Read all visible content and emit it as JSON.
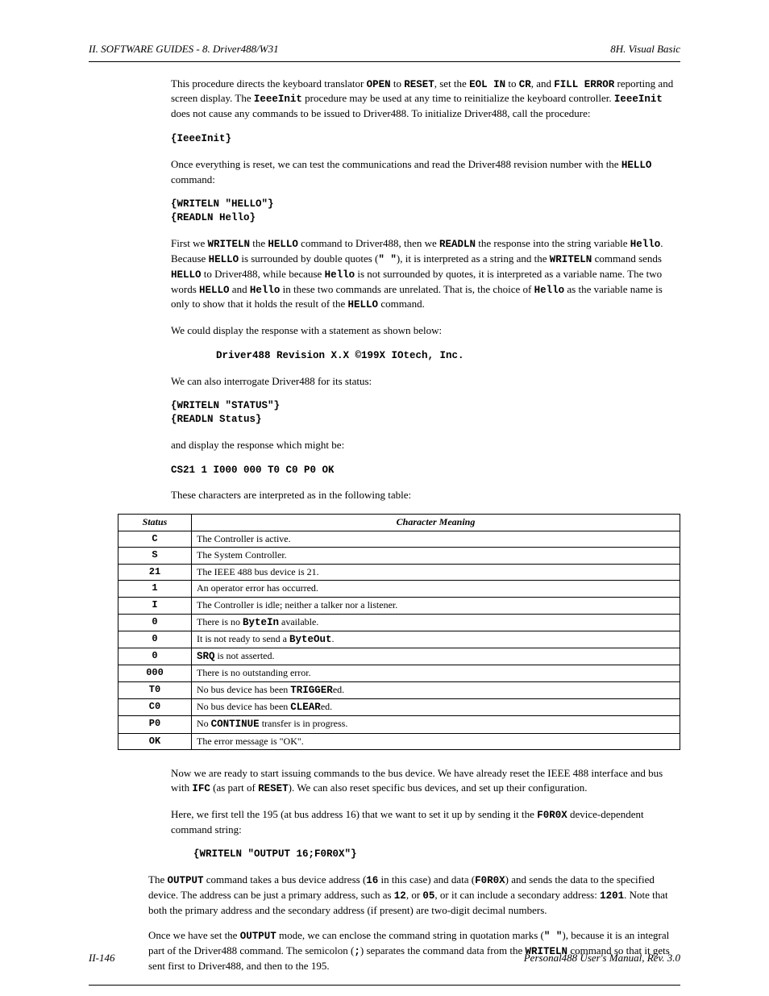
{
  "header": {
    "left": "II. SOFTWARE GUIDES - 8. Driver488/W31",
    "right": "8H. Visual Basic"
  },
  "p1": {
    "t1": "This procedure directs the keyboard translator ",
    "c1": "OPEN",
    "t2": " to ",
    "c2": "RESET",
    "t3": ", set the ",
    "c3": "EOL IN",
    "t4": " to ",
    "c4": "CR",
    "t5": ", and ",
    "c5": "FILL ERROR",
    "t6": " reporting and screen display. The ",
    "c6": "IeeeInit",
    "t7": " procedure may be used at any time to reinitialize the keyboard controller. ",
    "c7": "IeeeInit",
    "t8": " does not cause any commands to be issued to Driver488. To initialize Driver488, call the procedure:"
  },
  "code1": "{IeeeInit}",
  "p2": {
    "t1": "Once everything is reset, we can test the communications and read the Driver488 revision number with the ",
    "c1": "HELLO",
    "t2": " command:"
  },
  "code2a": "{WRITELN \"HELLO\"}",
  "code2b": "{READLN Hello}",
  "p3": {
    "t1": "First we ",
    "c1": "WRITELN",
    "t2": " the ",
    "c2": "HELLO",
    "t3": " command to Driver488, then we ",
    "c3": "READLN",
    "t4": " the response into the string variable ",
    "c4": "Hello",
    "t5": ". Because ",
    "c5": "HELLO",
    "t6": " is surrounded by double quotes (",
    "c6": "\" \"",
    "t7": "), it is interpreted as a string and the ",
    "c7": "WRITELN",
    "t8": " command sends ",
    "c8": "HELLO",
    "t9": " to Driver488, while because ",
    "c9": "Hello",
    "t10": " is not surrounded by quotes, it is interpreted as a variable name. The two words ",
    "c10": "HELLO",
    "t11": " and ",
    "c11": "Hello",
    "t12": " in these two commands are unrelated. That is, the choice of ",
    "c12": "Hello",
    "t13": " as the variable name is only to show that it holds the result of the ",
    "c13": "HELLO",
    "t14": " command."
  },
  "p4": "We could display the response with a statement as shown below:",
  "code3": "Driver488 Revision X.X ©199X IOtech, Inc.",
  "p5": "We can also interrogate Driver488 for its status:",
  "code4a": "{WRITELN \"STATUS\"}",
  "code4b": "{READLN Status}",
  "p6": "and display the response which might be:",
  "code5": "CS21 1 I000 000 T0 C0 P0 OK",
  "p7": "These characters are interpreted as in the following table:",
  "table": {
    "head": [
      "Status",
      "Character Meaning"
    ],
    "rows": [
      [
        "C",
        "The Controller is active."
      ],
      [
        "S",
        "The System Controller."
      ],
      [
        "21",
        "The IEEE 488 bus device is 21."
      ],
      [
        "1",
        "An operator error has occurred."
      ],
      [
        "I",
        "The Controller is idle; neither a talker nor a listener."
      ],
      [
        "0",
        "There is no <span class=\"mono\">ByteIn</span> available."
      ],
      [
        "0",
        "It is not ready to send a <span class=\"mono\">ByteOut</span>."
      ],
      [
        "0",
        "<span class=\"mono\">SRQ</span> is not asserted."
      ],
      [
        "000",
        "There is no outstanding error."
      ],
      [
        "T0",
        "No bus device has been <span class=\"mono\">TRIGGER</span>ed."
      ],
      [
        "C0",
        "No bus device has been <span class=\"mono\">CLEAR</span>ed."
      ],
      [
        "P0",
        "No <span class=\"mono\">CONTINUE</span> transfer is in progress."
      ],
      [
        "OK",
        "The error message is \"OK\"."
      ]
    ]
  },
  "p8": {
    "t1": "Now we are ready to start issuing commands to the bus device. We have already reset the IEEE 488 interface and bus with ",
    "c1": "IFC",
    "t2": " (as part of ",
    "c2": "RESET",
    "t3": "). We can also reset specific bus devices, and set up their configuration."
  },
  "p9": {
    "t1": "Here, we first tell the 195 (at bus address 16) that we want to set it up by sending it the ",
    "c1": "F0R0X",
    "t2": " device-dependent command string:"
  },
  "code6": "{WRITELN \"OUTPUT 16;F0R0X\"}",
  "p10": {
    "t1": "The ",
    "c1": "OUTPUT",
    "t2": " command takes a bus device address (",
    "c2": "16",
    "t3": " in this case) and data (",
    "c3": "F0R0X",
    "t4": ") and sends the data to the specified device. The address can be just a primary address, such as ",
    "c4": "12",
    "t5": ", or ",
    "c5": "05",
    "t6": ", or it can include a secondary address: ",
    "c6": "1201",
    "t7": ". Note that both the primary address and the secondary address (if present) are two-digit decimal numbers."
  },
  "p11": {
    "t1": "Once we have set the ",
    "c1": "OUTPUT",
    "t2": " mode, we can enclose the command string in quotation marks (",
    "c2": "\" \"",
    "t3": "), because it is an integral part of the Driver488 command. The semicolon (",
    "c3": ";",
    "t4": ") separates the command data from the ",
    "c4": "WRITELN",
    "t5": " command so that it gets sent first to Driver488, and then to the 195."
  },
  "footer": {
    "left": "II-146",
    "right": "Personal488 User's Manual, Rev. 3.0"
  }
}
